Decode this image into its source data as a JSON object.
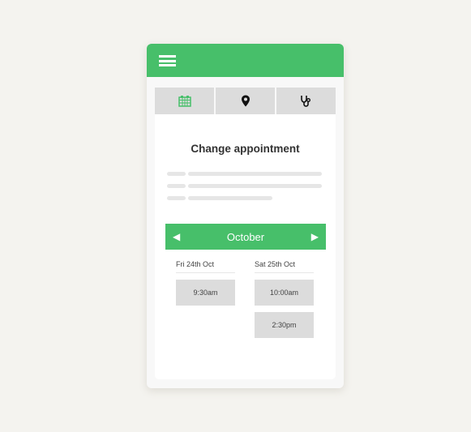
{
  "header": {
    "menu_icon": "hamburger-icon"
  },
  "tabs": [
    {
      "icon": "calendar-icon",
      "active": true
    },
    {
      "icon": "map-pin-icon",
      "active": false
    },
    {
      "icon": "stethoscope-icon",
      "active": false
    }
  ],
  "main": {
    "title": "Change appointment",
    "month": {
      "label": "October",
      "prev_icon": "◀",
      "next_icon": "▶"
    },
    "days": [
      {
        "label": "Fri 24th Oct",
        "slots": [
          "9:30am"
        ]
      },
      {
        "label": "Sat 25th Oct",
        "slots": [
          "10:00am",
          "2:30pm"
        ]
      }
    ]
  },
  "colors": {
    "accent": "#47bf6a",
    "background": "#f4f3ef",
    "tab_bg": "#dcdcdc"
  }
}
